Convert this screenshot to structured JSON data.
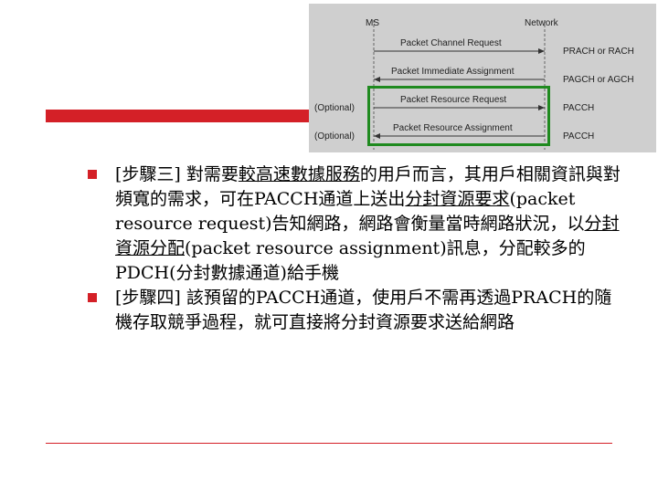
{
  "diagram": {
    "ms_label": "MS",
    "network_label": "Network",
    "messages": [
      {
        "text": "Packet Channel Request",
        "direction": "right",
        "channel": "PRACH or RACH",
        "optional": ""
      },
      {
        "text": "Packet Immediate Assignment",
        "direction": "left",
        "channel": "PAGCH or AGCH",
        "optional": ""
      },
      {
        "text": "Packet Resource Request",
        "direction": "right",
        "channel": "PACCH",
        "optional": "(Optional)"
      },
      {
        "text": "Packet Resource Assignment",
        "direction": "left",
        "channel": "PACCH",
        "optional": "(Optional)"
      }
    ],
    "highlight_color": "#1f8a1f"
  },
  "bullets": [
    {
      "parts": [
        {
          "text": "[步驟三] 對需要",
          "u": false
        },
        {
          "text": "較高速數據服務",
          "u": true
        },
        {
          "text": "的用戶而言，其用戶相關資訊與對頻寬的需求，可在PACCH通道上送出",
          "u": false
        },
        {
          "text": "分封資源要求",
          "u": true
        },
        {
          "text": "(packet resource request)告知網路，網路會衡量當時網路狀況，以",
          "u": false
        },
        {
          "text": "分封資源分配",
          "u": true
        },
        {
          "text": "(packet resource assignment)訊息，分配較多的PDCH(分封數據通道)給手機",
          "u": false
        }
      ]
    },
    {
      "parts": [
        {
          "text": "[步驟四] 該預留的PACCH通道，使用戶不需再透過PRACH的隨機存取競爭過程，就可直接將分封資源要求送給網路",
          "u": false
        }
      ]
    }
  ],
  "colors": {
    "accent": "#d42027"
  }
}
